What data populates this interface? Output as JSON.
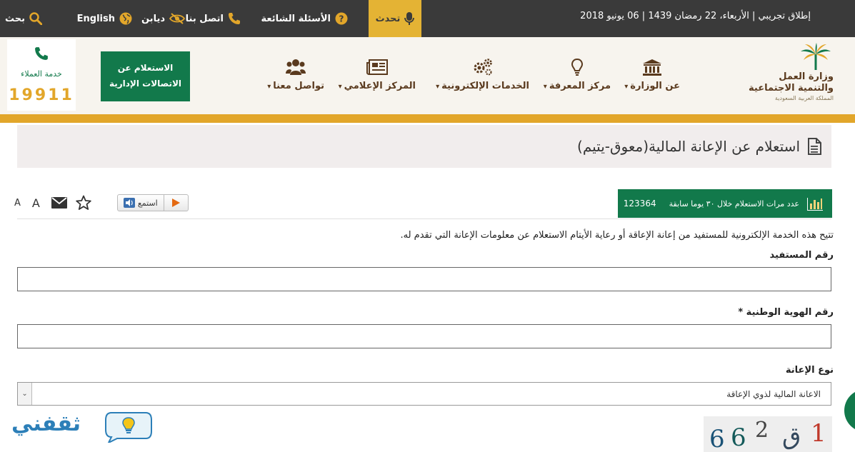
{
  "topbar": {
    "date": "إطلاق تجريبي | الأربعاء، 22 رمضان 1439 | 06 يونيو 2018",
    "talk": "تحدث",
    "faq": "الأسئلة الشائعة",
    "contact": "اتصل بنا",
    "disability": "ديابن",
    "english": "English",
    "search": "بحث"
  },
  "logo": {
    "line1": "وزارة العمل",
    "line2": "والتنمية الاجتماعية",
    "line3": "المملكة العربية السعودية"
  },
  "nav": {
    "ministry": "عن الوزارة",
    "knowledge": "مركز المعرفة",
    "eservices": "الخدمات الإلكترونية",
    "media": "المركز الإعلامي",
    "connect": "تواصل معنا"
  },
  "admin_inquiry": {
    "line1": "الاستعلام عن",
    "line2": "الاتصالات الإدارية"
  },
  "hotline": {
    "label": "خدمة العملاء",
    "number": "19911"
  },
  "page": {
    "title": "استعلام عن الإعانة المالية(معوق-يتيم)"
  },
  "stats": {
    "label": "عدد مرات الاستعلام خلال ٣٠ يوما سابقة",
    "count": "123364"
  },
  "tools": {
    "listen": "استمع",
    "font_small": "A",
    "font_big": "A"
  },
  "form": {
    "description": "تتيح هذه الخدمة الإلكترونية للمستفيد من إعانة الإعاقة أو رعاية الأيتام الاستعلام عن معلومات الإعانة التي تقدم له.",
    "beneficiary_label": "رقم المستفيد",
    "beneficiary_value": "",
    "national_id_label": "رقم الهوية الوطنية *",
    "national_id_value": "",
    "aid_type_label": "نوع الإعانة",
    "aid_type_selected": "الاعانة المالية لذوي الإعاقة"
  },
  "captcha": {
    "text": "662ق1"
  },
  "watermark": {
    "text": "ثقفني"
  },
  "colors": {
    "topbar": "#3a3a3a",
    "accent_gold": "#e2a62a",
    "brand_green": "#12794b",
    "header_bg": "#f7f4ee",
    "brown_text": "#5a3a1e"
  }
}
